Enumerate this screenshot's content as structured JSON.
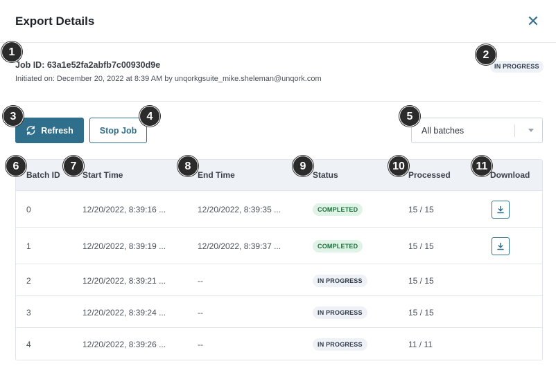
{
  "dialog": {
    "title": "Export Details",
    "close_icon": "close-icon"
  },
  "job": {
    "id_text": "Job ID: 63a1e52fa2abfb7c00930d9e",
    "initiated_text": "Initiated on: December 20, 2022 at 8:39 AM by unqorkgsuite_mike.sheleman@unqork.com",
    "status": "IN PROGRESS"
  },
  "toolbar": {
    "refresh_label": "Refresh",
    "refresh_icon": "refresh-icon",
    "stop_label": "Stop Job",
    "batch_filter": {
      "selected": "All batches",
      "caret_icon": "chevron-down-icon"
    }
  },
  "table": {
    "columns": [
      "Batch ID",
      "Start Time",
      "End Time",
      "Status",
      "Processed",
      "Download"
    ],
    "rows": [
      {
        "batch_id": "0",
        "start": "12/20/2022, 8:39:16 ...",
        "end": "12/20/2022, 8:39:35 ...",
        "status": "COMPLETED",
        "processed": "15 / 15",
        "download": true
      },
      {
        "batch_id": "1",
        "start": "12/20/2022, 8:39:19 ...",
        "end": "12/20/2022, 8:39:37 ...",
        "status": "COMPLETED",
        "processed": "15 / 15",
        "download": true
      },
      {
        "batch_id": "2",
        "start": "12/20/2022, 8:39:21 ...",
        "end": "--",
        "status": "IN PROGRESS",
        "processed": "15 / 15",
        "download": false
      },
      {
        "batch_id": "3",
        "start": "12/20/2022, 8:39:24 ...",
        "end": "--",
        "status": "IN PROGRESS",
        "processed": "15 / 15",
        "download": false
      },
      {
        "batch_id": "4",
        "start": "12/20/2022, 8:39:26 ...",
        "end": "--",
        "status": "IN PROGRESS",
        "processed": "11 / 11",
        "download": false
      }
    ]
  },
  "annotations": [
    "1",
    "2",
    "3",
    "4",
    "5",
    "6",
    "7",
    "8",
    "9",
    "10",
    "11"
  ],
  "colors": {
    "accent": "#2f6f8b",
    "completed_bg": "#dff4e6",
    "progress_bg": "#eef1f6",
    "marker": "#2b2b2b"
  }
}
